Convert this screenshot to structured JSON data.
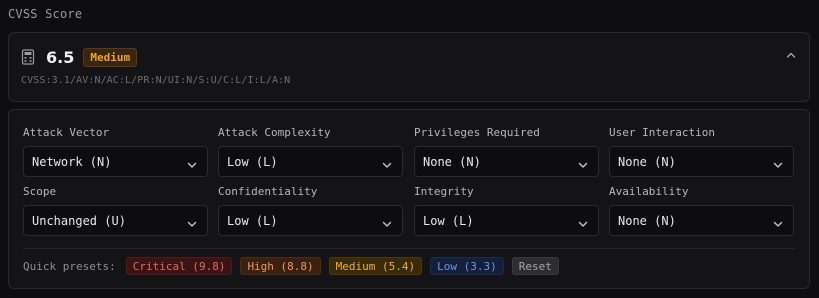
{
  "section": {
    "title": "CVSS Score"
  },
  "score": {
    "value": "6.5",
    "severity": "Medium",
    "vector": "CVSS:3.1/AV:N/AC:L/PR:N/UI:N/S:U/C:L/I:L/A:N"
  },
  "metrics": [
    {
      "label": "Attack Vector",
      "value": "Network (N)"
    },
    {
      "label": "Attack Complexity",
      "value": "Low (L)"
    },
    {
      "label": "Privileges Required",
      "value": "None (N)"
    },
    {
      "label": "User Interaction",
      "value": "None (N)"
    },
    {
      "label": "Scope",
      "value": "Unchanged (U)"
    },
    {
      "label": "Confidentiality",
      "value": "Low (L)"
    },
    {
      "label": "Integrity",
      "value": "Low (L)"
    },
    {
      "label": "Availability",
      "value": "None (N)"
    }
  ],
  "presets": {
    "label": "Quick presets:",
    "critical": "Critical (9.8)",
    "high": "High (8.8)",
    "medium": "Medium (5.4)",
    "low": "Low (3.3)",
    "reset": "Reset"
  },
  "colors": {
    "medium_badge": "#f0a330",
    "critical": "#e06a62",
    "high": "#ec9a5a",
    "low": "#6e96e6"
  },
  "icons": {
    "score": "calculator-icon",
    "collapse": "chevron-up-icon",
    "select": "chevron-down-icon"
  }
}
